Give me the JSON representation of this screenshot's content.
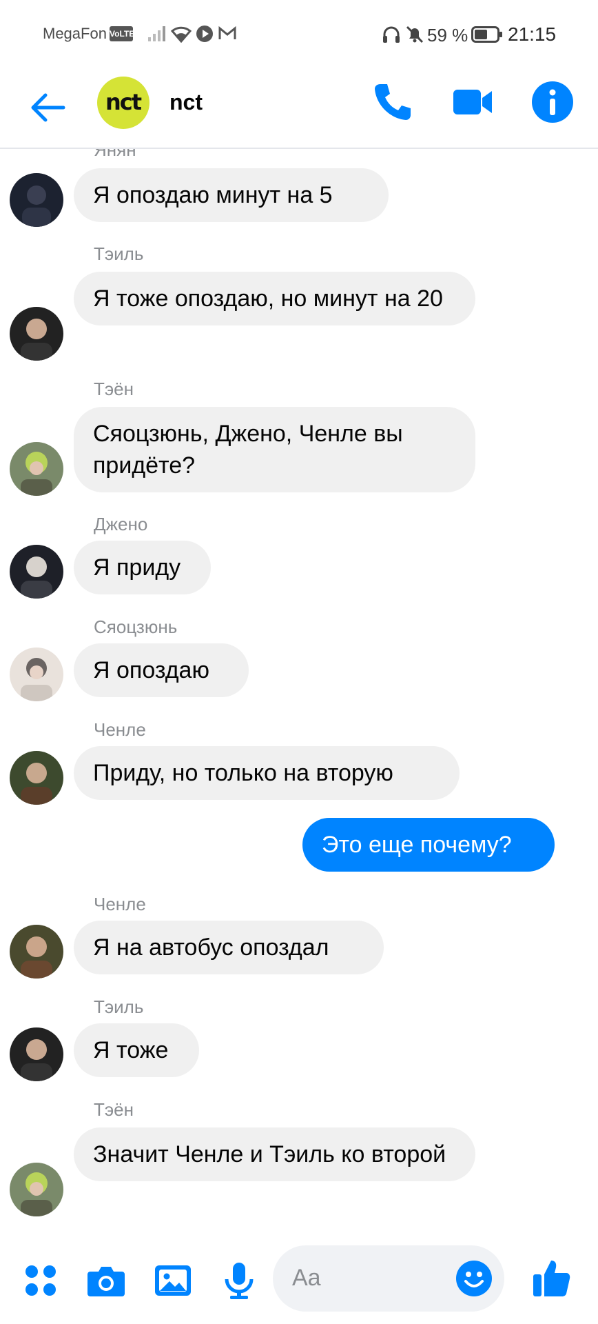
{
  "status": {
    "carrier": "MegaFon",
    "volte": "VoLTE",
    "battery_pct": "59 %",
    "time": "21:15"
  },
  "header": {
    "group_name": "nct",
    "group_logo": "nct",
    "accent": "#0084ff"
  },
  "messages": [
    {
      "sender": "Янян",
      "text": "Я опоздаю минут на 5",
      "dir": "in"
    },
    {
      "sender": "Тэиль",
      "text": "Я тоже опоздаю, но минут на 20",
      "dir": "in"
    },
    {
      "sender": "Тэён",
      "text": "Сяоцзюнь, Джено, Ченле вы придёте?",
      "dir": "in"
    },
    {
      "sender": "Джено",
      "text": "Я приду",
      "dir": "in"
    },
    {
      "sender": "Сяоцзюнь",
      "text": "Я опоздаю",
      "dir": "in"
    },
    {
      "sender": "Ченле",
      "text": "Приду, но только на вторую",
      "dir": "in"
    },
    {
      "sender": "",
      "text": "Это еще почему?",
      "dir": "out"
    },
    {
      "sender": "Ченле",
      "text": "Я на автобус опоздал",
      "dir": "in"
    },
    {
      "sender": "Тэиль",
      "text": "Я тоже",
      "dir": "in"
    },
    {
      "sender": "Тэён",
      "text": "Значит Ченле и Тэиль ко второй",
      "dir": "in"
    }
  ],
  "composer": {
    "placeholder": "Aa"
  }
}
